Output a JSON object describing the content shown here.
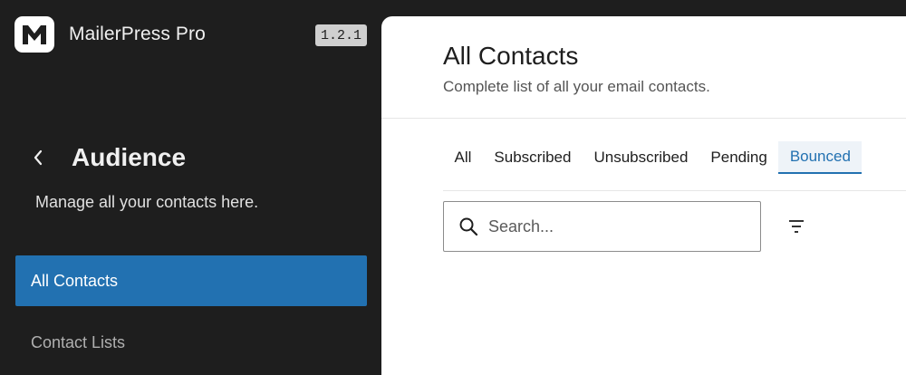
{
  "app": {
    "name": "MailerPress Pro",
    "version": "1.2.1",
    "logo_icon": "mailerpress-logo-icon"
  },
  "sidebar": {
    "back_icon": "chevron-left-icon",
    "section_title": "Audience",
    "section_description": "Manage all your contacts here.",
    "items": [
      {
        "label": "All Contacts",
        "active": true
      },
      {
        "label": "Contact Lists",
        "active": false
      }
    ],
    "accent_color": "#2271b1"
  },
  "main": {
    "title": "All Contacts",
    "subtitle": "Complete list of all your email contacts.",
    "tabs": [
      {
        "label": "All",
        "selected": false
      },
      {
        "label": "Subscribed",
        "selected": false
      },
      {
        "label": "Unsubscribed",
        "selected": false
      },
      {
        "label": "Pending",
        "selected": false
      },
      {
        "label": "Bounced",
        "selected": true
      }
    ],
    "search": {
      "placeholder": "Search...",
      "value": "",
      "icon": "search-icon"
    },
    "filter_icon": "filter-icon"
  }
}
